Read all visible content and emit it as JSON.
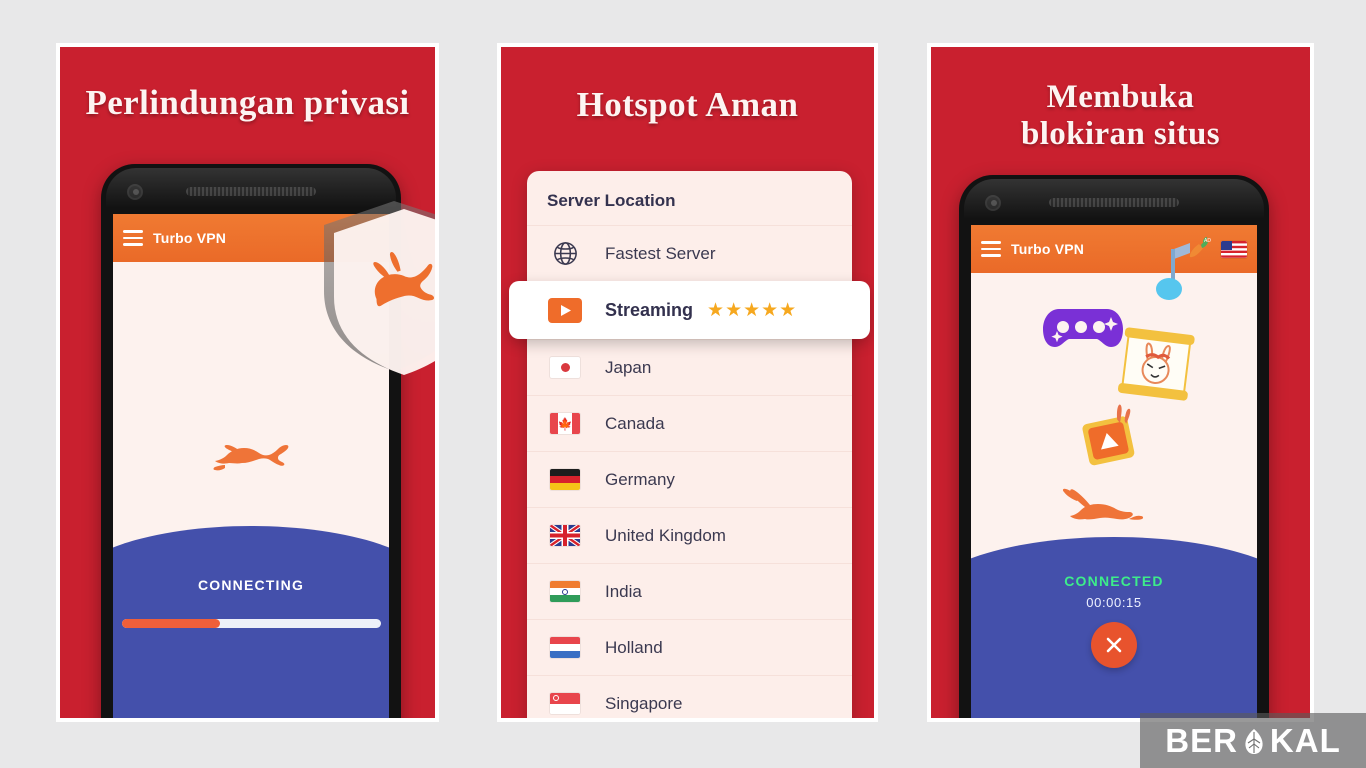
{
  "background_color": "#e8e8e9",
  "panels": [
    {
      "id": "panel-1",
      "title": "Perlindungan privasi",
      "accent_red": "#c9202f",
      "phone": {
        "appbar": {
          "title": "Turbo VPN",
          "menu_icon": "hamburger-icon"
        },
        "status": "CONNECTING",
        "progress_percent": 38,
        "overlay_icon": "shield-rabbit-icon"
      }
    },
    {
      "id": "panel-2",
      "title": "Hotspot Aman",
      "accent_red": "#c9202f",
      "card": {
        "title": "Server Location",
        "rows": [
          {
            "label": "Fastest Server",
            "icon": "globe-icon",
            "highlighted": false,
            "stars": null
          },
          {
            "label": "Streaming",
            "icon": "video-play-icon",
            "highlighted": true,
            "stars": "★★★★★"
          },
          {
            "label": "Japan",
            "icon": "flag-japan-icon",
            "highlighted": false,
            "stars": null
          },
          {
            "label": "Canada",
            "icon": "flag-canada-icon",
            "highlighted": false,
            "stars": null
          },
          {
            "label": "Germany",
            "icon": "flag-germany-icon",
            "highlighted": false,
            "stars": null
          },
          {
            "label": "United Kingdom",
            "icon": "flag-united-kingdom-icon",
            "highlighted": false,
            "stars": null
          },
          {
            "label": "India",
            "icon": "flag-india-icon",
            "highlighted": false,
            "stars": null
          },
          {
            "label": "Holland",
            "icon": "flag-holland-icon",
            "highlighted": false,
            "stars": null
          },
          {
            "label": "Singapore",
            "icon": "flag-singapore-icon",
            "highlighted": false,
            "stars": null
          }
        ]
      }
    },
    {
      "id": "panel-3",
      "title_line_1": "Membuka",
      "title_line_2": "blokiran situs",
      "accent_red": "#c9202f",
      "phone": {
        "appbar": {
          "title": "Turbo VPN",
          "menu_icon": "hamburger-icon",
          "icons": [
            "music-note-icon",
            "carrot-icon",
            "flag-usa-icon"
          ]
        },
        "status": "CONNECTED",
        "timer": "00:00:15",
        "disconnect_icon": "close-x-icon",
        "floating_icons": [
          "gamepad-icon",
          "rabbit-poster-icon",
          "video-play-badge-icon"
        ]
      }
    }
  ],
  "colors": {
    "red": "#c9202f",
    "orange": "#ef6c2a",
    "blue": "#4450ab",
    "connected_green": "#3ded8a",
    "star_gold": "#f6a81f",
    "screen_bg": "#fdf2ee"
  },
  "watermark": {
    "text_left": "BER",
    "text_right": "KAL",
    "logo_icon": "leaf-emblem-icon"
  }
}
